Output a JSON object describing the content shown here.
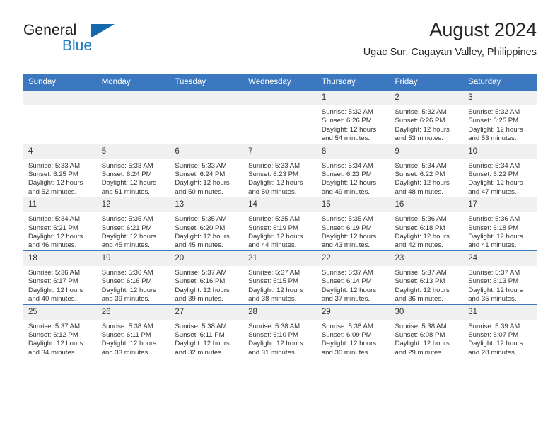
{
  "brand": {
    "name_part1": "General",
    "name_part2": "Blue",
    "logo_icon": "triangle-flag-icon"
  },
  "header": {
    "month_title": "August 2024",
    "location": "Ugac Sur, Cagayan Valley, Philippines"
  },
  "colors": {
    "header_blue": "#3b78bf",
    "brand_blue": "#1878be",
    "daynum_bg": "#f0f0f0",
    "text": "#333333"
  },
  "weekday_headers": [
    "Sunday",
    "Monday",
    "Tuesday",
    "Wednesday",
    "Thursday",
    "Friday",
    "Saturday"
  ],
  "weeks": [
    [
      {
        "day": "",
        "empty": true,
        "sunrise": "",
        "sunset": "",
        "daylight_line1": "",
        "daylight_line2": ""
      },
      {
        "day": "",
        "empty": true,
        "sunrise": "",
        "sunset": "",
        "daylight_line1": "",
        "daylight_line2": ""
      },
      {
        "day": "",
        "empty": true,
        "sunrise": "",
        "sunset": "",
        "daylight_line1": "",
        "daylight_line2": ""
      },
      {
        "day": "",
        "empty": true,
        "sunrise": "",
        "sunset": "",
        "daylight_line1": "",
        "daylight_line2": ""
      },
      {
        "day": "1",
        "empty": false,
        "sunrise": "Sunrise: 5:32 AM",
        "sunset": "Sunset: 6:26 PM",
        "daylight_line1": "Daylight: 12 hours",
        "daylight_line2": "and 54 minutes."
      },
      {
        "day": "2",
        "empty": false,
        "sunrise": "Sunrise: 5:32 AM",
        "sunset": "Sunset: 6:26 PM",
        "daylight_line1": "Daylight: 12 hours",
        "daylight_line2": "and 53 minutes."
      },
      {
        "day": "3",
        "empty": false,
        "sunrise": "Sunrise: 5:32 AM",
        "sunset": "Sunset: 6:25 PM",
        "daylight_line1": "Daylight: 12 hours",
        "daylight_line2": "and 53 minutes."
      }
    ],
    [
      {
        "day": "4",
        "empty": false,
        "sunrise": "Sunrise: 5:33 AM",
        "sunset": "Sunset: 6:25 PM",
        "daylight_line1": "Daylight: 12 hours",
        "daylight_line2": "and 52 minutes."
      },
      {
        "day": "5",
        "empty": false,
        "sunrise": "Sunrise: 5:33 AM",
        "sunset": "Sunset: 6:24 PM",
        "daylight_line1": "Daylight: 12 hours",
        "daylight_line2": "and 51 minutes."
      },
      {
        "day": "6",
        "empty": false,
        "sunrise": "Sunrise: 5:33 AM",
        "sunset": "Sunset: 6:24 PM",
        "daylight_line1": "Daylight: 12 hours",
        "daylight_line2": "and 50 minutes."
      },
      {
        "day": "7",
        "empty": false,
        "sunrise": "Sunrise: 5:33 AM",
        "sunset": "Sunset: 6:23 PM",
        "daylight_line1": "Daylight: 12 hours",
        "daylight_line2": "and 50 minutes."
      },
      {
        "day": "8",
        "empty": false,
        "sunrise": "Sunrise: 5:34 AM",
        "sunset": "Sunset: 6:23 PM",
        "daylight_line1": "Daylight: 12 hours",
        "daylight_line2": "and 49 minutes."
      },
      {
        "day": "9",
        "empty": false,
        "sunrise": "Sunrise: 5:34 AM",
        "sunset": "Sunset: 6:22 PM",
        "daylight_line1": "Daylight: 12 hours",
        "daylight_line2": "and 48 minutes."
      },
      {
        "day": "10",
        "empty": false,
        "sunrise": "Sunrise: 5:34 AM",
        "sunset": "Sunset: 6:22 PM",
        "daylight_line1": "Daylight: 12 hours",
        "daylight_line2": "and 47 minutes."
      }
    ],
    [
      {
        "day": "11",
        "empty": false,
        "sunrise": "Sunrise: 5:34 AM",
        "sunset": "Sunset: 6:21 PM",
        "daylight_line1": "Daylight: 12 hours",
        "daylight_line2": "and 46 minutes."
      },
      {
        "day": "12",
        "empty": false,
        "sunrise": "Sunrise: 5:35 AM",
        "sunset": "Sunset: 6:21 PM",
        "daylight_line1": "Daylight: 12 hours",
        "daylight_line2": "and 45 minutes."
      },
      {
        "day": "13",
        "empty": false,
        "sunrise": "Sunrise: 5:35 AM",
        "sunset": "Sunset: 6:20 PM",
        "daylight_line1": "Daylight: 12 hours",
        "daylight_line2": "and 45 minutes."
      },
      {
        "day": "14",
        "empty": false,
        "sunrise": "Sunrise: 5:35 AM",
        "sunset": "Sunset: 6:19 PM",
        "daylight_line1": "Daylight: 12 hours",
        "daylight_line2": "and 44 minutes."
      },
      {
        "day": "15",
        "empty": false,
        "sunrise": "Sunrise: 5:35 AM",
        "sunset": "Sunset: 6:19 PM",
        "daylight_line1": "Daylight: 12 hours",
        "daylight_line2": "and 43 minutes."
      },
      {
        "day": "16",
        "empty": false,
        "sunrise": "Sunrise: 5:36 AM",
        "sunset": "Sunset: 6:18 PM",
        "daylight_line1": "Daylight: 12 hours",
        "daylight_line2": "and 42 minutes."
      },
      {
        "day": "17",
        "empty": false,
        "sunrise": "Sunrise: 5:36 AM",
        "sunset": "Sunset: 6:18 PM",
        "daylight_line1": "Daylight: 12 hours",
        "daylight_line2": "and 41 minutes."
      }
    ],
    [
      {
        "day": "18",
        "empty": false,
        "sunrise": "Sunrise: 5:36 AM",
        "sunset": "Sunset: 6:17 PM",
        "daylight_line1": "Daylight: 12 hours",
        "daylight_line2": "and 40 minutes."
      },
      {
        "day": "19",
        "empty": false,
        "sunrise": "Sunrise: 5:36 AM",
        "sunset": "Sunset: 6:16 PM",
        "daylight_line1": "Daylight: 12 hours",
        "daylight_line2": "and 39 minutes."
      },
      {
        "day": "20",
        "empty": false,
        "sunrise": "Sunrise: 5:37 AM",
        "sunset": "Sunset: 6:16 PM",
        "daylight_line1": "Daylight: 12 hours",
        "daylight_line2": "and 39 minutes."
      },
      {
        "day": "21",
        "empty": false,
        "sunrise": "Sunrise: 5:37 AM",
        "sunset": "Sunset: 6:15 PM",
        "daylight_line1": "Daylight: 12 hours",
        "daylight_line2": "and 38 minutes."
      },
      {
        "day": "22",
        "empty": false,
        "sunrise": "Sunrise: 5:37 AM",
        "sunset": "Sunset: 6:14 PM",
        "daylight_line1": "Daylight: 12 hours",
        "daylight_line2": "and 37 minutes."
      },
      {
        "day": "23",
        "empty": false,
        "sunrise": "Sunrise: 5:37 AM",
        "sunset": "Sunset: 6:13 PM",
        "daylight_line1": "Daylight: 12 hours",
        "daylight_line2": "and 36 minutes."
      },
      {
        "day": "24",
        "empty": false,
        "sunrise": "Sunrise: 5:37 AM",
        "sunset": "Sunset: 6:13 PM",
        "daylight_line1": "Daylight: 12 hours",
        "daylight_line2": "and 35 minutes."
      }
    ],
    [
      {
        "day": "25",
        "empty": false,
        "sunrise": "Sunrise: 5:37 AM",
        "sunset": "Sunset: 6:12 PM",
        "daylight_line1": "Daylight: 12 hours",
        "daylight_line2": "and 34 minutes."
      },
      {
        "day": "26",
        "empty": false,
        "sunrise": "Sunrise: 5:38 AM",
        "sunset": "Sunset: 6:11 PM",
        "daylight_line1": "Daylight: 12 hours",
        "daylight_line2": "and 33 minutes."
      },
      {
        "day": "27",
        "empty": false,
        "sunrise": "Sunrise: 5:38 AM",
        "sunset": "Sunset: 6:11 PM",
        "daylight_line1": "Daylight: 12 hours",
        "daylight_line2": "and 32 minutes."
      },
      {
        "day": "28",
        "empty": false,
        "sunrise": "Sunrise: 5:38 AM",
        "sunset": "Sunset: 6:10 PM",
        "daylight_line1": "Daylight: 12 hours",
        "daylight_line2": "and 31 minutes."
      },
      {
        "day": "29",
        "empty": false,
        "sunrise": "Sunrise: 5:38 AM",
        "sunset": "Sunset: 6:09 PM",
        "daylight_line1": "Daylight: 12 hours",
        "daylight_line2": "and 30 minutes."
      },
      {
        "day": "30",
        "empty": false,
        "sunrise": "Sunrise: 5:38 AM",
        "sunset": "Sunset: 6:08 PM",
        "daylight_line1": "Daylight: 12 hours",
        "daylight_line2": "and 29 minutes."
      },
      {
        "day": "31",
        "empty": false,
        "sunrise": "Sunrise: 5:39 AM",
        "sunset": "Sunset: 6:07 PM",
        "daylight_line1": "Daylight: 12 hours",
        "daylight_line2": "and 28 minutes."
      }
    ]
  ]
}
